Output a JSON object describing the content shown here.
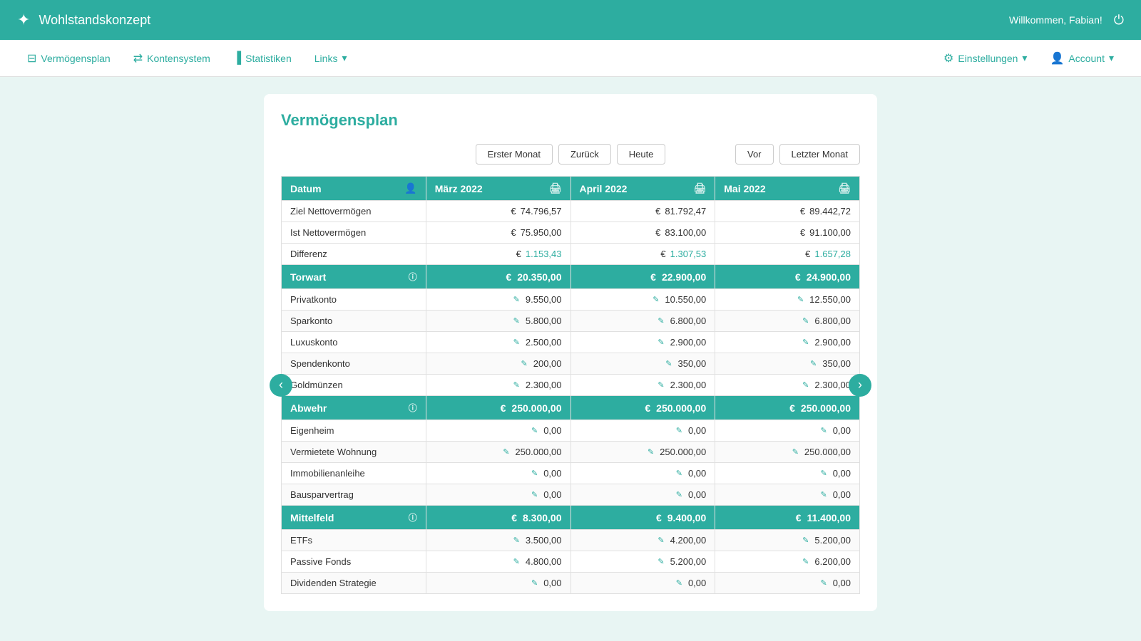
{
  "header": {
    "logo_text": "✦✦",
    "app_title": "Wohlstandskonzept",
    "welcome_text": "Willkommen, Fabian!",
    "logout_label": "→"
  },
  "nav": {
    "items": [
      {
        "id": "vermogensplan",
        "icon": "⊟",
        "label": "Vermögensplan"
      },
      {
        "id": "kontensystem",
        "icon": "⇄",
        "label": "Kontensystem"
      },
      {
        "id": "statistiken",
        "icon": "📊",
        "label": "Statistiken"
      },
      {
        "id": "links",
        "icon": "",
        "label": "Links",
        "has_arrow": true
      }
    ],
    "right_items": [
      {
        "id": "einstellungen",
        "icon": "⚙",
        "label": "Einstellungen",
        "has_arrow": true
      },
      {
        "id": "account",
        "icon": "👤",
        "label": "Account",
        "has_arrow": true
      }
    ]
  },
  "page": {
    "title": "Vermögensplan",
    "nav_buttons": [
      {
        "id": "erster-monat",
        "label": "Erster Monat"
      },
      {
        "id": "zuruck",
        "label": "Zurück"
      },
      {
        "id": "heute",
        "label": "Heute"
      }
    ],
    "nav_buttons_right": [
      {
        "id": "vor",
        "label": "Vor"
      },
      {
        "id": "letzter-monat",
        "label": "Letzter Monat"
      }
    ]
  },
  "table": {
    "header_label": "Datum",
    "months": [
      {
        "title": "März 2022",
        "id": "marz"
      },
      {
        "title": "April 2022",
        "id": "april"
      },
      {
        "title": "Mai 2022",
        "id": "mai"
      }
    ],
    "summary_rows": [
      {
        "label": "Ziel Nettovermögen",
        "values": [
          "74.796,57",
          "81.792,47",
          "89.442,72"
        ],
        "positive": false
      },
      {
        "label": "Ist Nettovermögen",
        "values": [
          "75.950,00",
          "83.100,00",
          "91.100,00"
        ],
        "positive": false
      },
      {
        "label": "Differenz",
        "values": [
          "1.153,43",
          "1.307,53",
          "1.657,28"
        ],
        "positive": true
      }
    ],
    "categories": [
      {
        "name": "Torwart",
        "totals": [
          "20.350,00",
          "22.900,00",
          "24.900,00"
        ],
        "items": [
          {
            "label": "Privatkonto",
            "values": [
              "9.550,00",
              "10.550,00",
              "12.550,00"
            ]
          },
          {
            "label": "Sparkonto",
            "values": [
              "5.800,00",
              "6.800,00",
              "6.800,00"
            ]
          },
          {
            "label": "Luxuskonto",
            "values": [
              "2.500,00",
              "2.900,00",
              "2.900,00"
            ]
          },
          {
            "label": "Spendenkonto",
            "values": [
              "200,00",
              "350,00",
              "350,00"
            ]
          },
          {
            "label": "Goldmünzen",
            "values": [
              "2.300,00",
              "2.300,00",
              "2.300,00"
            ]
          }
        ]
      },
      {
        "name": "Abwehr",
        "totals": [
          "250.000,00",
          "250.000,00",
          "250.000,00"
        ],
        "items": [
          {
            "label": "Eigenheim",
            "values": [
              "0,00",
              "0,00",
              "0,00"
            ]
          },
          {
            "label": "Vermietete Wohnung",
            "values": [
              "250.000,00",
              "250.000,00",
              "250.000,00"
            ]
          },
          {
            "label": "Immobilienanleihe",
            "values": [
              "0,00",
              "0,00",
              "0,00"
            ]
          },
          {
            "label": "Bausparvertrag",
            "values": [
              "0,00",
              "0,00",
              "0,00"
            ]
          }
        ]
      },
      {
        "name": "Mittelfeld",
        "totals": [
          "8.300,00",
          "9.400,00",
          "11.400,00"
        ],
        "items": [
          {
            "label": "ETFs",
            "values": [
              "3.500,00",
              "4.200,00",
              "5.200,00"
            ]
          },
          {
            "label": "Passive Fonds",
            "values": [
              "4.800,00",
              "5.200,00",
              "6.200,00"
            ]
          },
          {
            "label": "Dividenden Strategie",
            "values": [
              "0,00",
              "0,00",
              "0,00"
            ]
          }
        ]
      }
    ]
  }
}
